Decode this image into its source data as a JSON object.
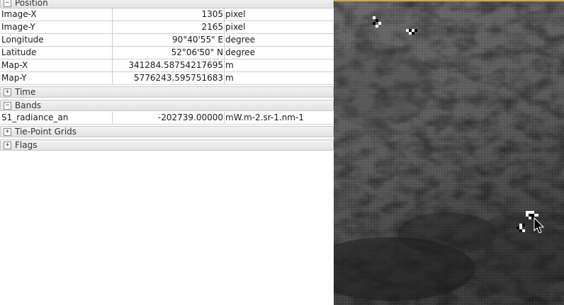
{
  "sections": {
    "position": {
      "label": "Position",
      "toggle": "−"
    },
    "time": {
      "label": "Time",
      "toggle": "+"
    },
    "bands": {
      "label": "Bands",
      "toggle": "−"
    },
    "tiepoint": {
      "label": "Tie-Point Grids",
      "toggle": "+"
    },
    "flags": {
      "label": "Flags",
      "toggle": "+"
    }
  },
  "position_rows": [
    {
      "name": "Image-X",
      "value": "1305",
      "unit": "pixel"
    },
    {
      "name": "Image-Y",
      "value": "2165",
      "unit": "pixel"
    },
    {
      "name": "Longitude",
      "value": "90°40'55\" E",
      "unit": "degree"
    },
    {
      "name": "Latitude",
      "value": "52°06'50\" N",
      "unit": "degree"
    },
    {
      "name": "Map-X",
      "value": "341284.58754217695",
      "unit": "m"
    },
    {
      "name": "Map-Y",
      "value": "5776243.595751683",
      "unit": "m"
    }
  ],
  "band_rows": [
    {
      "name": "S1_radiance_an",
      "value": "-202739.00000",
      "unit": "mW.m-2.sr-1.nm-1"
    }
  ],
  "icons": {
    "cursor": "mouse-pointer-icon"
  }
}
